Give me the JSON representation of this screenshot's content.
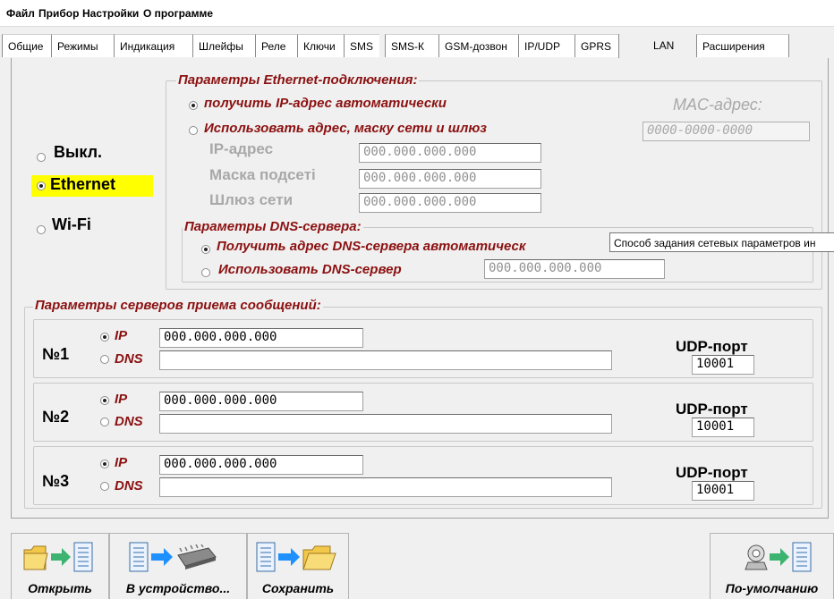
{
  "menu": {
    "items": [
      "Файл",
      "Прибор",
      "Настройки",
      "О программе"
    ]
  },
  "tabs": [
    "Общие",
    "Режимы",
    "Индикация",
    "Шлейфы",
    "Реле",
    "Ключи",
    "SMS",
    "SMS-К",
    "GSM-дозвон",
    "IP/UDP",
    "GPRS",
    "LAN",
    "Расширения"
  ],
  "active_tab": "LAN",
  "mode": {
    "off_label": "Выкл.",
    "ethernet_label": "Ethernet",
    "wifi_label": "Wi-Fi",
    "selected": "Ethernet",
    "highlight_color": "#ffff00"
  },
  "ethernet": {
    "title": "Параметры Ethernet-подключения:",
    "auto_label": "получить IP-адрес автоматически",
    "manual_label": "Использовать адрес, маску сети и шлюз",
    "selected": "auto",
    "mac_label": "MAC-адрес:",
    "mac_value": "0000-0000-0000",
    "ip_label": "IP-адрес",
    "ip_value": "000.000.000.000",
    "mask_label": "Маска подсеті",
    "mask_value": "000.000.000.000",
    "gateway_label": "Шлюз сети",
    "gateway_value": "000.000.000.000"
  },
  "dns": {
    "title": "Параметры DNS-сервера:",
    "auto_label": "Получить адрес DNS-сервера автоматическ",
    "manual_label": "Использовать DNS-сервер",
    "selected": "auto",
    "dns_value": "000.000.000.000"
  },
  "tooltip": "Способ задания сетевых параметров ин",
  "servers": {
    "title": "Параметры серверов приема сообщений:",
    "ip_option": "IP",
    "dns_option": "DNS",
    "udp_label": "UDP-порт",
    "items": [
      {
        "num": "№1",
        "ip": "000.000.000.000",
        "dns": "",
        "port": "10001",
        "selected": "IP"
      },
      {
        "num": "№2",
        "ip": "000.000.000.000",
        "dns": "",
        "port": "10001",
        "selected": "IP"
      },
      {
        "num": "№3",
        "ip": "000.000.000.000",
        "dns": "",
        "port": "10001",
        "selected": "IP"
      }
    ]
  },
  "toolbar": {
    "open_label": "Открыть",
    "device_label": "В устройство...",
    "save_label": "Сохранить",
    "default_label": "По-умолчанию"
  },
  "colors": {
    "accent_red": "#8b1010",
    "disabled_gray": "#a8a8a8",
    "arrow_green": "#3cb371",
    "arrow_blue": "#1e90ff",
    "folder_yellow": "#f2c84b"
  }
}
